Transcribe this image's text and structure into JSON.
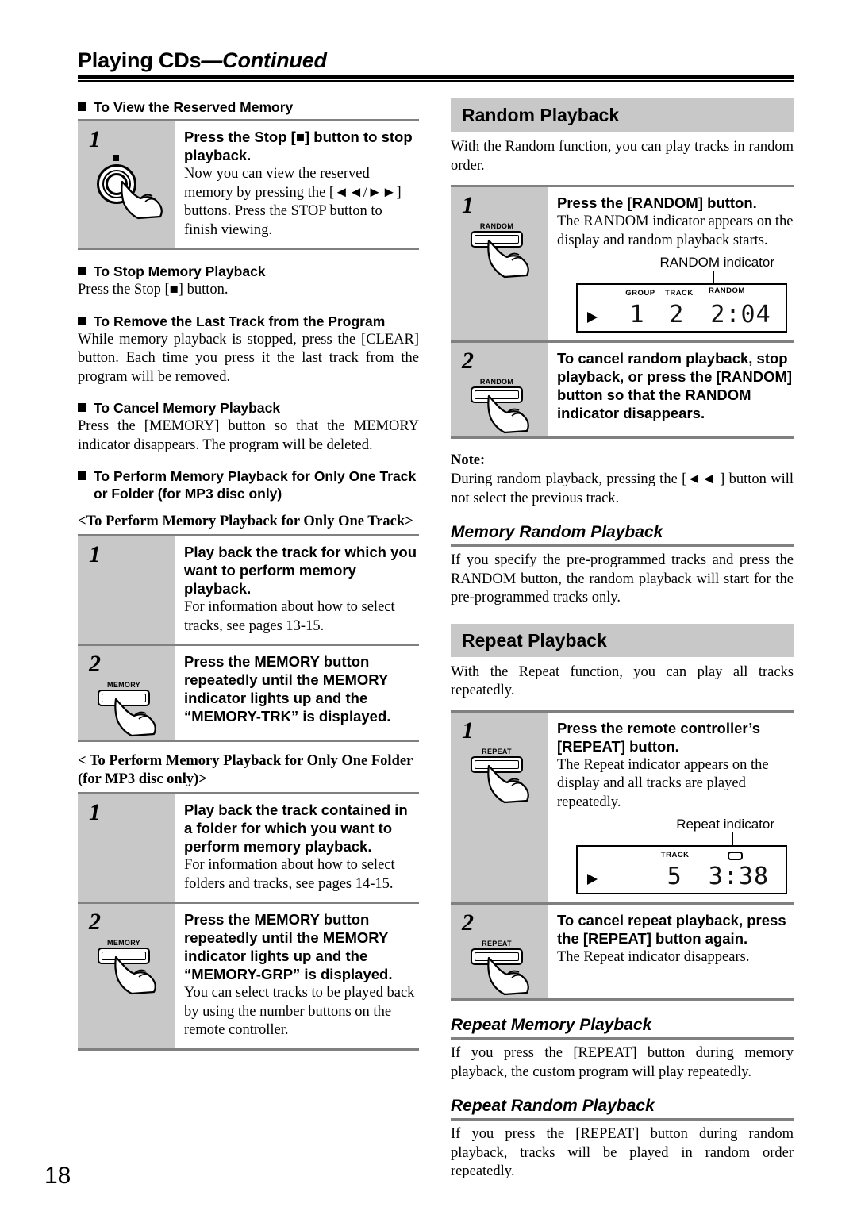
{
  "runhead": {
    "title_main": "Playing CDs",
    "title_cont": "—Continued"
  },
  "page_number": "18",
  "left_column": {
    "h_view_reserved": "To View the Reserved Memory",
    "step_view": {
      "num": "1",
      "title": "Press the Stop [■] button to stop playback.",
      "text": "Now you can view the reserved memory by pressing the [◄◄/►►] buttons. Press the STOP button to finish viewing.",
      "icon_label": "stop-knob"
    },
    "h_stop_memory": "To Stop Memory Playback",
    "p_stop_memory": "Press the Stop [■] button.",
    "h_remove_last": "To Remove the Last Track from the Program",
    "p_remove_last": "While memory playback is stopped, press the [CLEAR] button. Each time you press it the last track from the program will be removed.",
    "h_cancel_memory": "To Cancel Memory Playback",
    "p_cancel_memory": "Press the [MEMORY] button so that the MEMORY indicator disappears. The program will be deleted.",
    "h_perform_only_one": "To Perform Memory Playback for Only One Track or Folder (for MP3 disc only)",
    "angle_track": "<To Perform Memory Playback for Only One Track>",
    "track_step1": {
      "num": "1",
      "title": "Play back the track for which you want to perform memory playback.",
      "text": "For information about how to select tracks, see pages 13-15."
    },
    "track_step2": {
      "num": "2",
      "title": "Press the MEMORY button repeatedly until the MEMORY indicator lights up and the “MEMORY-TRK” is displayed.",
      "button_label": "MEMORY"
    },
    "angle_folder": "< To Perform Memory Playback for Only One Folder (for MP3 disc only)>",
    "folder_step1": {
      "num": "1",
      "title": "Play back the track contained in a folder for which you want to perform memory playback.",
      "text": "For information about how to select folders and tracks, see pages 14-15."
    },
    "folder_step2": {
      "num": "2",
      "title": "Press the MEMORY button repeatedly until the MEMORY indicator lights up and the “MEMORY-GRP” is displayed.",
      "text": "You can select tracks to be played back by using the number buttons on the remote controller.",
      "button_label": "MEMORY"
    }
  },
  "right_column": {
    "random_section": {
      "heading": "Random Playback",
      "intro": "With the Random function, you can play tracks in random order.",
      "step1": {
        "num": "1",
        "title": "Press the [RANDOM] button.",
        "text": "The RANDOM indicator appears on the display and random playback starts.",
        "button_label": "RANDOM"
      },
      "lcd": {
        "caption": "RANDOM indicator",
        "tag_group": "GROUP",
        "tag_track": "TRACK",
        "tag_random": "RANDOM",
        "group_value": "1",
        "track_value": "2",
        "time_value": "2:04"
      },
      "step2": {
        "num": "2",
        "title": "To cancel random playback, stop playback, or press the [RANDOM] button so that the RANDOM indicator disappears.",
        "button_label": "RANDOM"
      },
      "note_label": "Note:",
      "note_text": "During random playback, pressing the [◄◄ ] button will not select the previous track."
    },
    "memory_random": {
      "heading": "Memory Random Playback",
      "text": "If you specify the pre-programmed tracks and press the RANDOM button, the random playback will start for the pre-programmed tracks only."
    },
    "repeat_section": {
      "heading": "Repeat Playback",
      "intro": "With the Repeat function, you can play all tracks repeatedly.",
      "step1": {
        "num": "1",
        "title": "Press the remote controller’s [REPEAT] button.",
        "text": "The Repeat indicator appears on the display and all tracks are played repeatedly.",
        "button_label": "REPEAT"
      },
      "lcd": {
        "caption": "Repeat indicator",
        "tag_track": "TRACK",
        "track_value": "5",
        "time_value": "3:38"
      },
      "step2": {
        "num": "2",
        "title": "To cancel repeat playback, press the [REPEAT] button again.",
        "text": "The Repeat indicator disappears.",
        "button_label": "REPEAT"
      }
    },
    "repeat_memory": {
      "heading": "Repeat Memory Playback",
      "text": "If you press the [REPEAT] button during memory playback, the custom program will play repeatedly."
    },
    "repeat_random": {
      "heading": "Repeat Random Playback",
      "text": "If you press the [REPEAT] button during random playback, tracks will be played in random order repeatedly."
    }
  }
}
